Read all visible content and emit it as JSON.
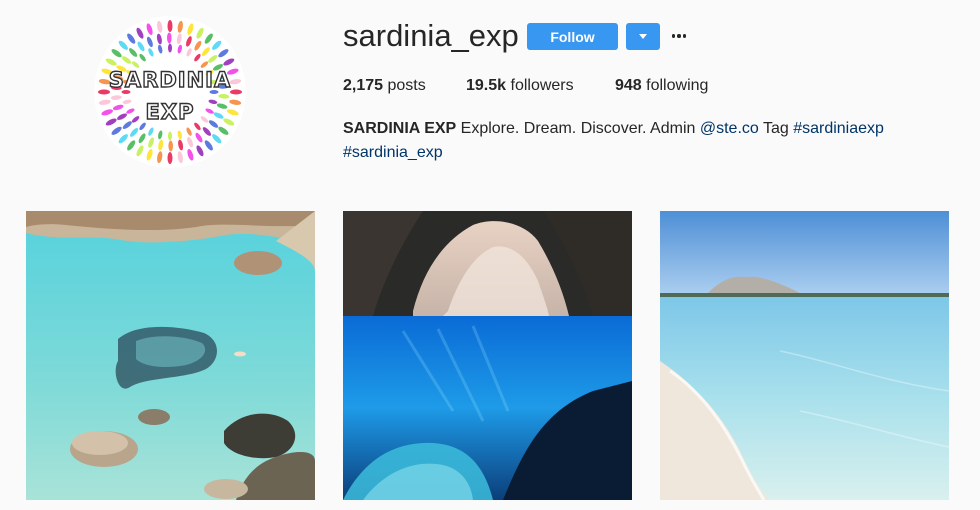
{
  "profile": {
    "username": "sardinia_exp",
    "avatar_text_line1": "SARDINIA",
    "avatar_text_line2": "EXP",
    "follow_label": "Follow",
    "dropdown_icon": "caret-down-icon",
    "more_icon": "ellipsis-icon",
    "accent_color": "#3897f0"
  },
  "stats": {
    "posts_count": "2,175",
    "posts_label": "posts",
    "followers_count": "19.5k",
    "followers_label": "followers",
    "following_count": "948",
    "following_label": "following"
  },
  "bio": {
    "name": "SARDINIA EXP",
    "text": "Explore. Dream. Discover. Admin",
    "mention": "@ste.co",
    "tag_label": "Tag",
    "hashtag1": "#sardiniaexp",
    "hashtag2": "#sardinia_exp",
    "link_color": "#003569"
  },
  "posts": [
    {
      "subject": "aerial turquoise cove with rocks"
    },
    {
      "subject": "sea cave above and below water"
    },
    {
      "subject": "clear shallow beach with island"
    }
  ]
}
